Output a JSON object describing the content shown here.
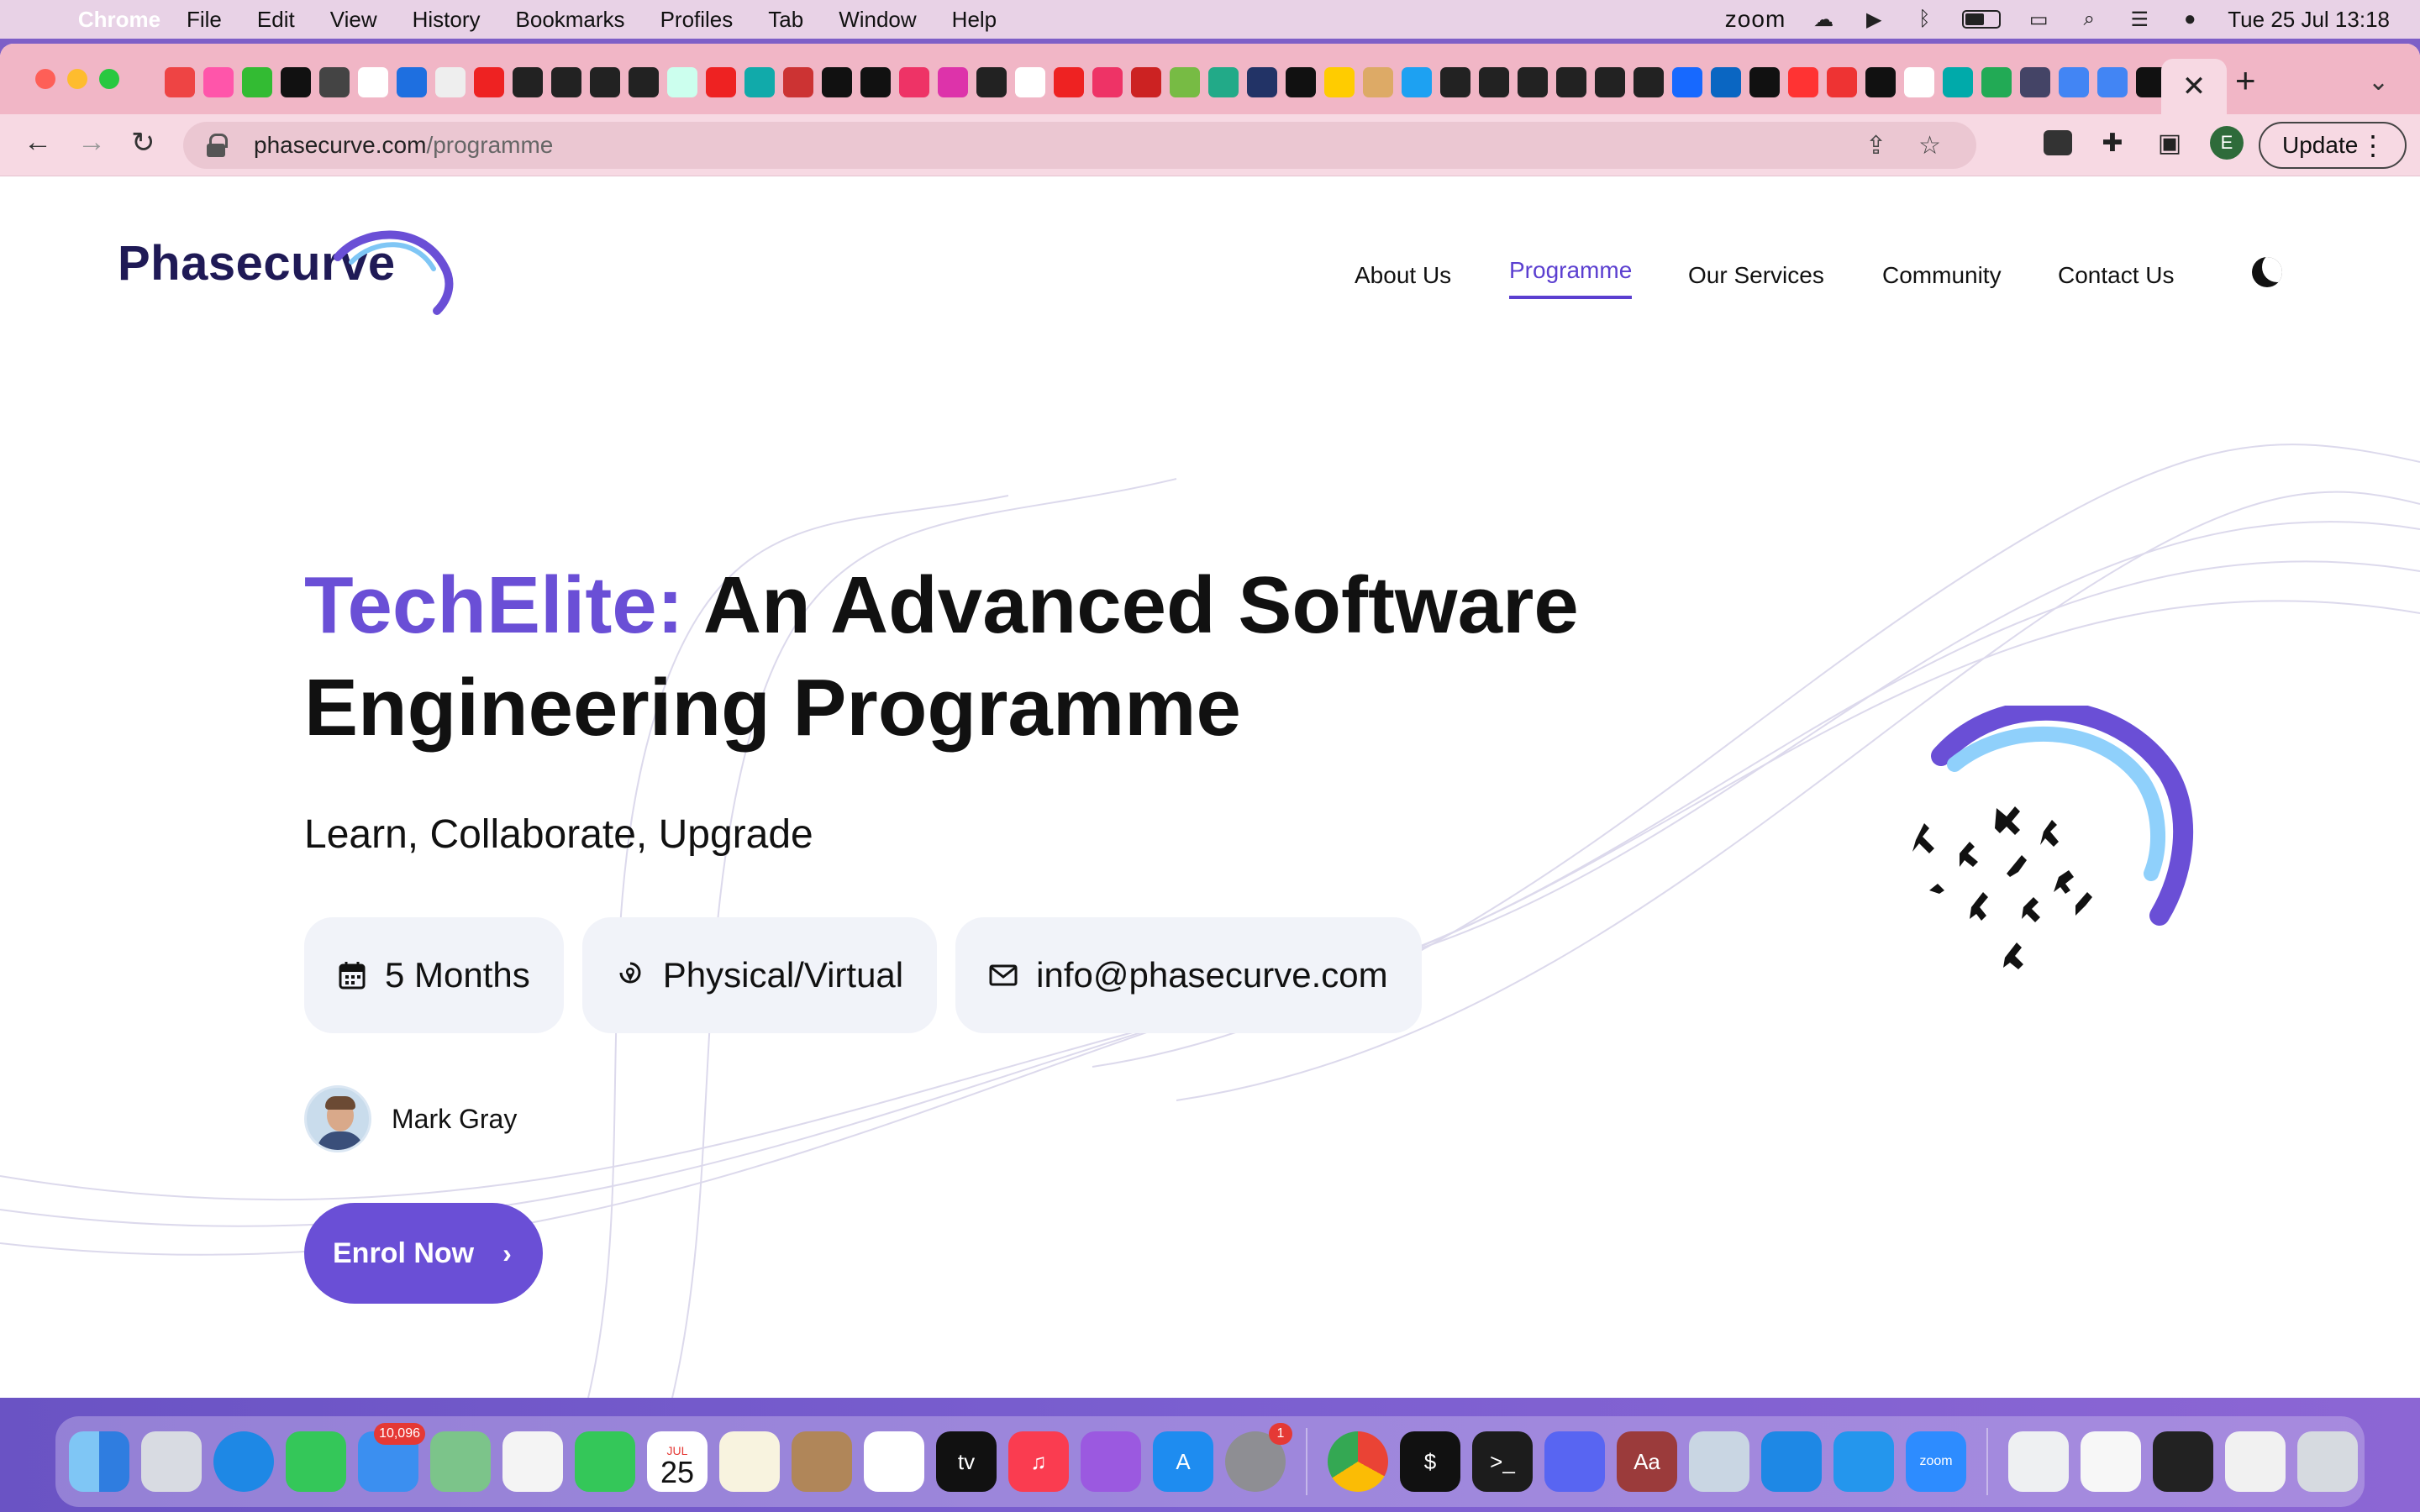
{
  "menubar": {
    "app_name": "Chrome",
    "items": [
      "File",
      "Edit",
      "View",
      "History",
      "Bookmarks",
      "Profiles",
      "Tab",
      "Window",
      "Help"
    ],
    "zoom_label": "zoom",
    "datetime": "Tue 25 Jul  13:18"
  },
  "browser": {
    "url_host": "phasecurve.com",
    "url_path": "/programme",
    "update_label": "Update",
    "profile_initial": "E"
  },
  "site": {
    "logo_text": "Phasecurve",
    "nav": [
      "About Us",
      "Programme",
      "Our Services",
      "Community",
      "Contact Us"
    ],
    "active_nav": "Programme",
    "accent_color": "#6a4fd6"
  },
  "hero": {
    "title_accent": "TechElite:",
    "title_rest": " An Advanced Software Engineering Programme",
    "tagline": "Learn, Collaborate, Upgrade",
    "chips": [
      {
        "icon": "calendar-icon",
        "label": "5 Months"
      },
      {
        "icon": "location-icon",
        "label": "Physical/Virtual"
      },
      {
        "icon": "mail-icon",
        "label": "info@phasecurve.com"
      }
    ],
    "mentor_name": "Mark Gray",
    "cta_label": "Enrol Now"
  },
  "dock": {
    "mail_badge": "10,096",
    "settings_badge": "1",
    "calendar_month": "JUL",
    "calendar_day": "25"
  }
}
